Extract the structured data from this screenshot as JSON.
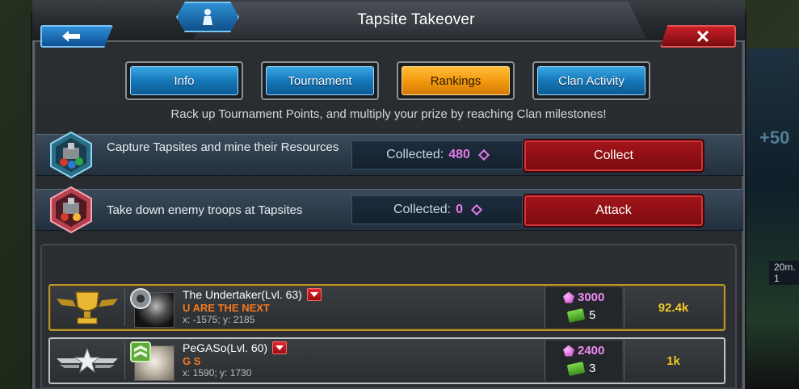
{
  "header": {
    "title": "Tapsite Takeover"
  },
  "tabs": [
    {
      "label": "Info",
      "active": false
    },
    {
      "label": "Tournament",
      "active": false
    },
    {
      "label": "Rankings",
      "active": true
    },
    {
      "label": "Clan Activity",
      "active": false
    }
  ],
  "subtitle": "Rack up Tournament Points, and multiply your prize by reaching Clan milestones!",
  "quests": [
    {
      "text": "Capture Tapsites and mine their Resources",
      "collected_label": "Collected:",
      "collected_value": "480",
      "action_label": "Collect",
      "icon": "capture-tapsite-icon"
    },
    {
      "text": "Take down enemy troops at Tapsites",
      "collected_label": "Collected:",
      "collected_value": "0",
      "action_label": "Attack",
      "icon": "attack-tapsite-icon"
    }
  ],
  "rankings": [
    {
      "rank_icon": "gold-trophy-icon",
      "player": "The Undertaker(Lvl. 63)",
      "clan": "U ARE THE NEXT",
      "coords": "x: -1575; y: 2185",
      "points": "3000",
      "troops": "5",
      "total": "92.4k"
    },
    {
      "rank_icon": "silver-wings-icon",
      "player": "PeGASo(Lvl. 60)",
      "clan": "G S",
      "coords": "x: 1590; y: 1730",
      "points": "2400",
      "troops": "3",
      "total": "1k"
    }
  ],
  "background": {
    "distance_label": "20m. 1"
  },
  "colors": {
    "accent_blue": "#1677b8",
    "active_tab": "#f49a10",
    "action_red": "#8b0e13",
    "points_pink": "#e57ae8",
    "total_gold": "#f2c82a",
    "clan_orange": "#f47a1f"
  }
}
